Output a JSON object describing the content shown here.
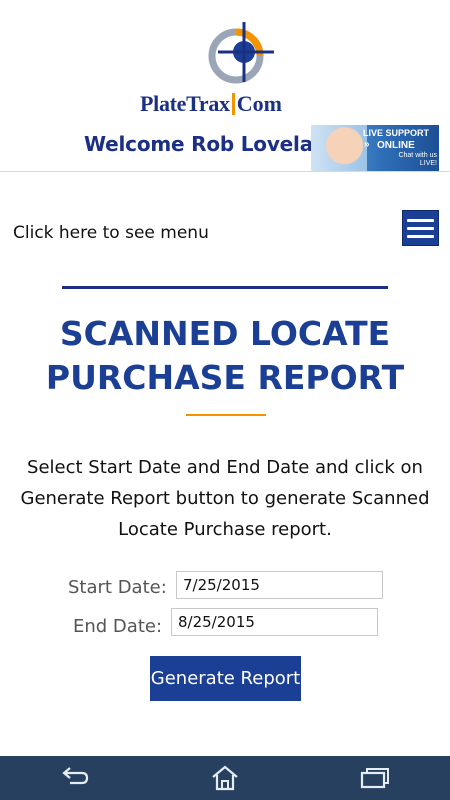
{
  "logo": {
    "text_primary": "PlateTrax",
    "text_secondary": "Com"
  },
  "header": {
    "welcome_text": "Welcome Rob Lovelace!",
    "live_support": {
      "line1": "LIVE SUPPORT",
      "line2": "ONLINE",
      "line3": "Chat with us LIVE!"
    }
  },
  "menu": {
    "label": "Click here to see menu",
    "icon": "hamburger-menu-icon"
  },
  "page": {
    "title": "SCANNED LOCATE PURCHASE REPORT",
    "instructions": "Select Start Date and End Date and click on Generate Report button to generate Scanned Locate Purchase report."
  },
  "form": {
    "start_date_label": "Start Date:",
    "start_date_value": "7/25/2015",
    "end_date_label": "End Date:",
    "end_date_value": "8/25/2015",
    "generate_label": "Generate Report"
  },
  "navbar": {
    "icons": [
      "back-icon",
      "home-icon",
      "recent-apps-icon"
    ]
  },
  "colors": {
    "brand_blue": "#1b3f94",
    "accent_orange": "#f29400",
    "navbar": "#274060"
  }
}
